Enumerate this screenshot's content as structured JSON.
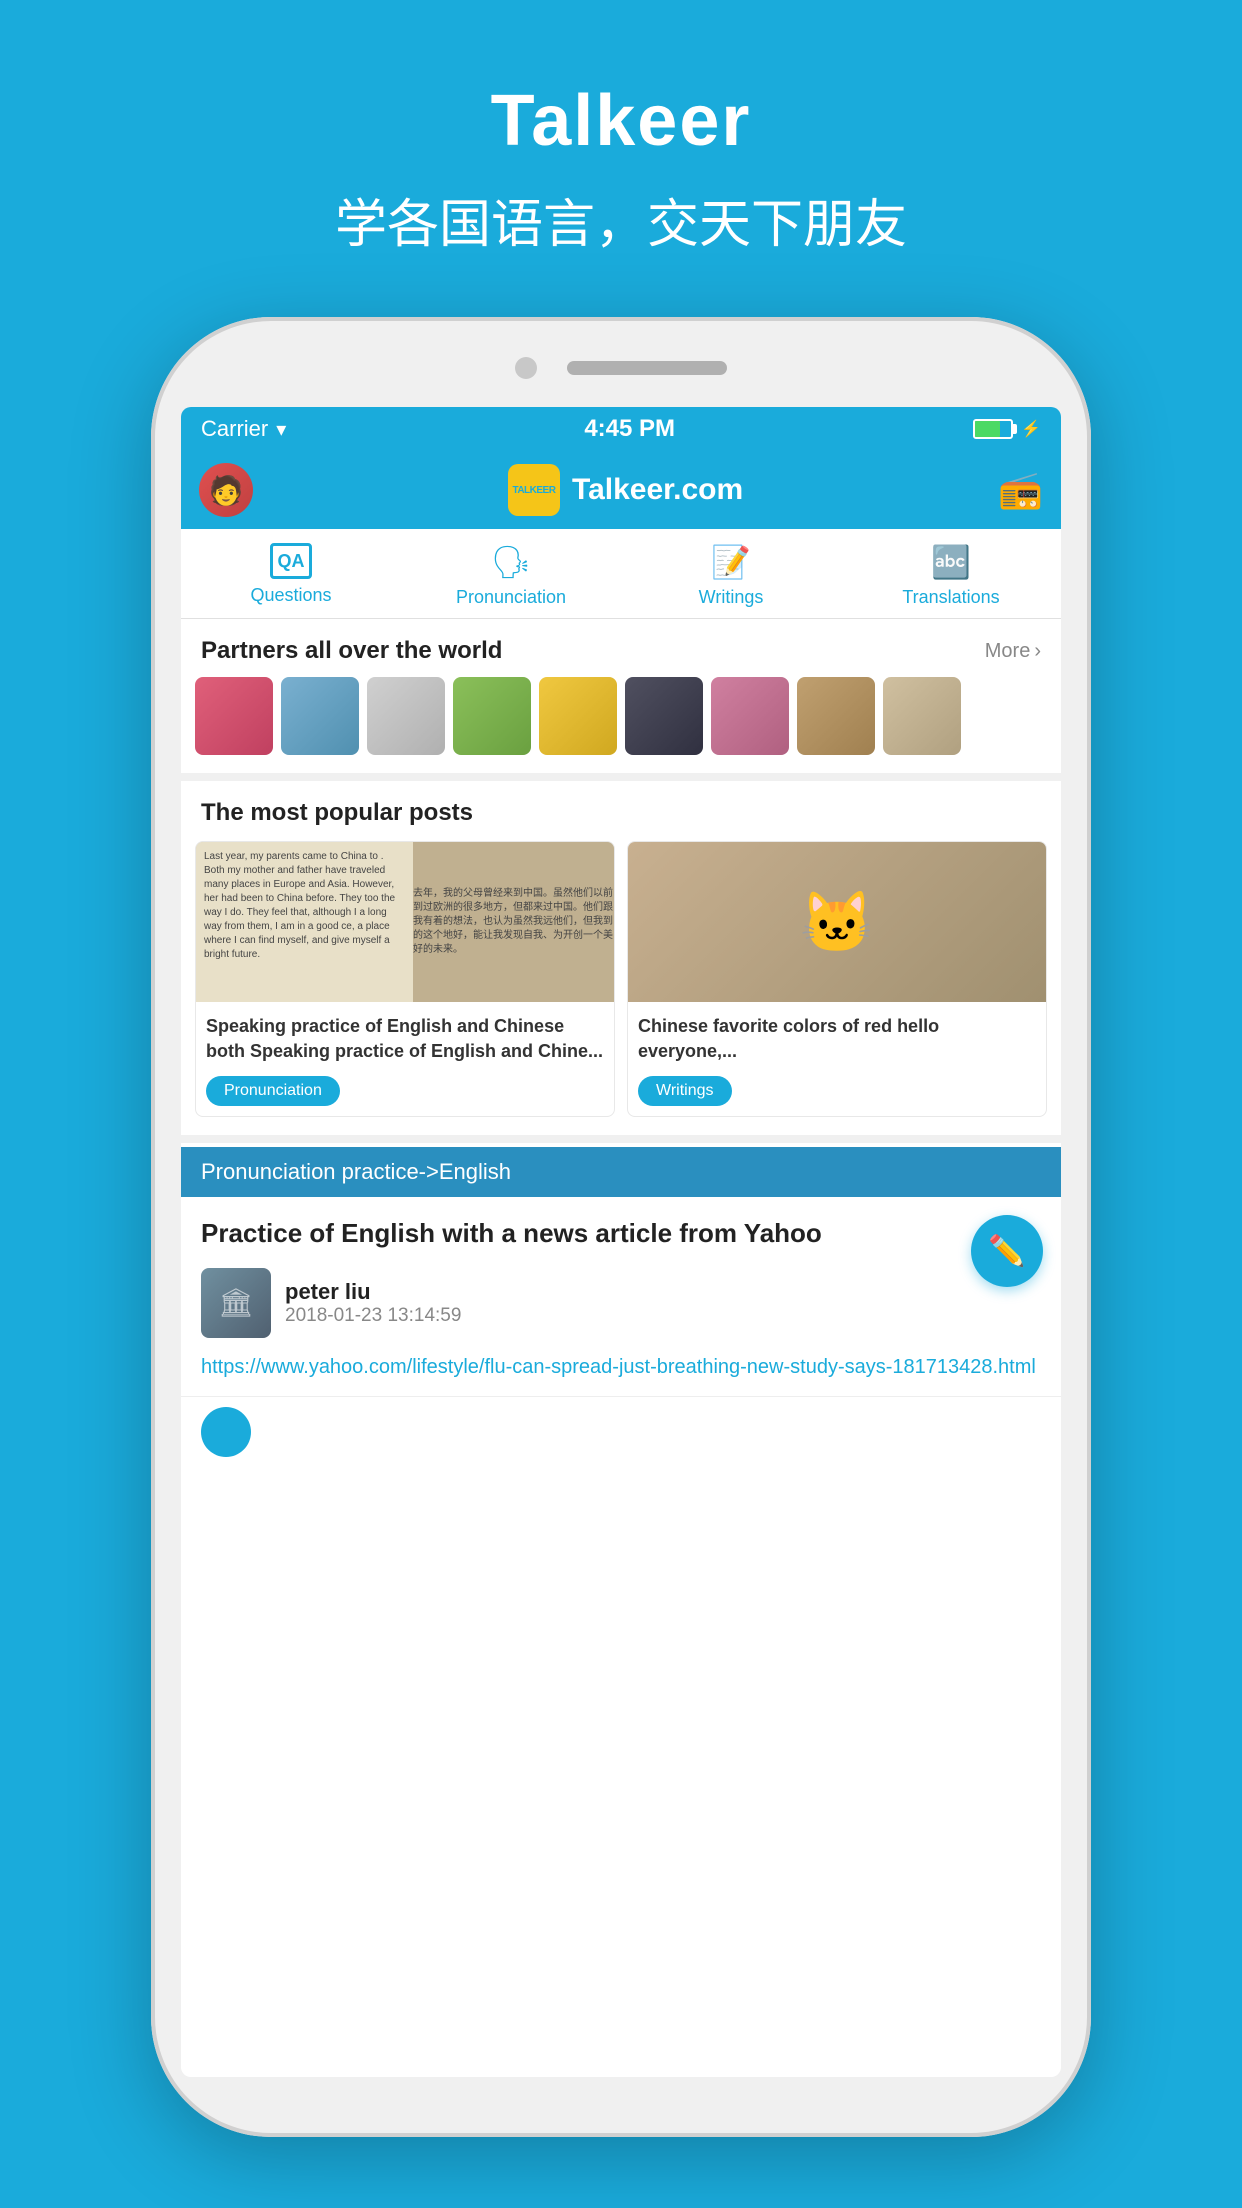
{
  "app": {
    "title": "Talkeer",
    "subtitle": "学各国语言，交天下朋友"
  },
  "status_bar": {
    "carrier": "Carrier",
    "time": "4:45 PM"
  },
  "header": {
    "logo_text": "Talkeer.com",
    "logo_badge": "TALKEER"
  },
  "nav": {
    "tabs": [
      {
        "id": "questions",
        "label": "Questions"
      },
      {
        "id": "pronunciation",
        "label": "Pronunciation"
      },
      {
        "id": "writings",
        "label": "Writings"
      },
      {
        "id": "translations",
        "label": "Translations"
      }
    ]
  },
  "partners": {
    "title": "Partners all over the world",
    "more_label": "More"
  },
  "popular_posts": {
    "title": "The most popular posts",
    "posts": [
      {
        "id": "post-1",
        "title": "Speaking practice of English and Chinese both Speaking practice of English and Chine...",
        "badge": "Pronunciation",
        "image_text_left": "Last year, my parents came to China to . Both my mother and father have traveled many places in Europe and Asia. However, her had been to China before. They too the way I do. They feel that, although I a long way from them, I am in a good ce, a place where I can find myself, and give myself a bright future.",
        "image_text_right": "去年，我的父母曾经来到中国。虽然他们以前到过欧洲的很多地方，但都来过中国。他们跟我有着的想法，也认为虽然我远他们，但我到的这个地好，能让我发现自我、为开创一个美好的未来。"
      },
      {
        "id": "post-2",
        "title": "Chinese favorite colors of red hello everyone,...",
        "badge": "Writings"
      }
    ]
  },
  "practice_section": {
    "header_label": "Pronunciation practice->English",
    "title": "Practice of  English with a news  article from Yahoo",
    "author_name": "peter liu",
    "author_date": "2018-01-23 13:14:59",
    "link": "https://www.yahoo.com/lifestyle/flu-can-spread-just-breathing-new-study-says-181713428.html"
  }
}
